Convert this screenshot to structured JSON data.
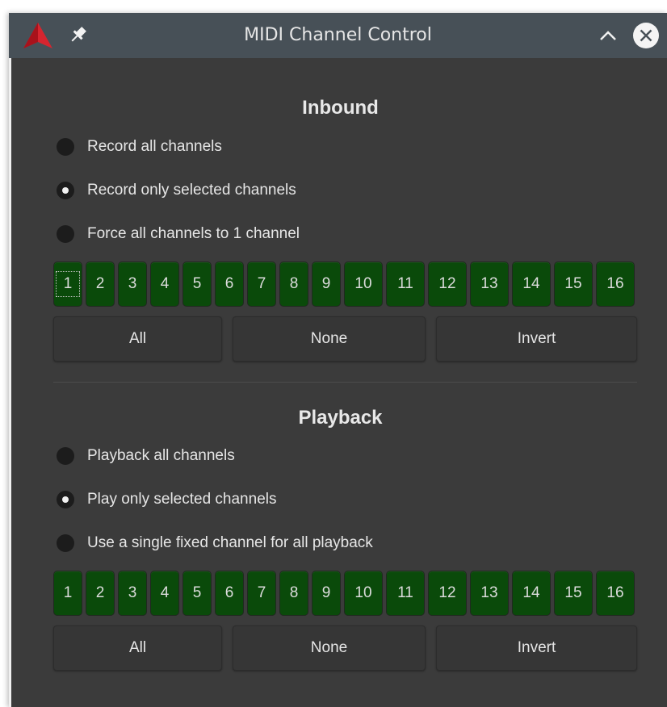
{
  "window": {
    "title": "MIDI Channel Control",
    "icons": {
      "app": "app-logo-icon",
      "pin": "pin-icon",
      "collapse": "chevron-up-icon",
      "close": "close-icon"
    }
  },
  "inbound": {
    "title": "Inbound",
    "options": [
      {
        "label": "Record all channels",
        "checked": false
      },
      {
        "label": "Record only selected channels",
        "checked": true
      },
      {
        "label": "Force all channels to 1 channel",
        "checked": false
      }
    ],
    "channels": [
      "1",
      "2",
      "3",
      "4",
      "5",
      "6",
      "7",
      "8",
      "9",
      "10",
      "11",
      "12",
      "13",
      "14",
      "15",
      "16"
    ],
    "buttons": {
      "all": "All",
      "none": "None",
      "invert": "Invert"
    }
  },
  "playback": {
    "title": "Playback",
    "options": [
      {
        "label": "Playback all channels",
        "checked": false
      },
      {
        "label": "Play only selected channels",
        "checked": true
      },
      {
        "label": "Use a single fixed channel for all playback",
        "checked": false
      }
    ],
    "channels": [
      "1",
      "2",
      "3",
      "4",
      "5",
      "6",
      "7",
      "8",
      "9",
      "10",
      "11",
      "12",
      "13",
      "14",
      "15",
      "16"
    ],
    "buttons": {
      "all": "All",
      "none": "None",
      "invert": "Invert"
    }
  },
  "colors": {
    "window_bg": "#3b3b3b",
    "titlebar_bg": "#475057",
    "channel_green": "#0a4a0a",
    "app_icon_red": "#d6252f"
  }
}
